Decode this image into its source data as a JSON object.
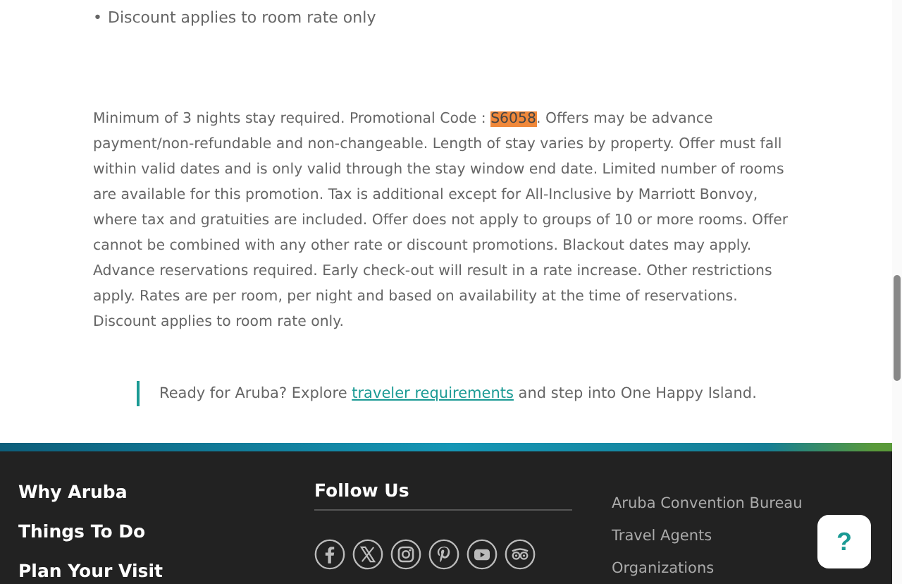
{
  "bullet_item": {
    "bullet": "•",
    "text": "Discount applies to room rate only"
  },
  "terms": {
    "before": "Minimum of 3 nights stay required. Promotional Code : ",
    "code": "S6058",
    "after": ". Offers may be advance payment/non-refundable and non-changeable. Length of stay varies by property. Offer must fall within valid dates and is only valid through the stay window end date. Limited number of rooms are available for this promotion. Tax is additional except for All-Inclusive by Marriott Bonvoy, where tax and gratuities are included. Offer does not apply to groups of 10 or more rooms. Offer cannot be combined with any other rate or discount promotions. Blackout dates may apply. Advance reservations required. Early check-out will result in a rate increase. Other restrictions apply. Rates are per room, per night and based on availability at the time of reservations. Discount applies to room rate only."
  },
  "callout": {
    "before": "Ready for Aruba? Explore ",
    "link": "traveler requirements",
    "after": " and step into One Happy Island."
  },
  "footer": {
    "nav": [
      "Why Aruba",
      "Things To Do",
      "Plan Your Visit"
    ],
    "follow_heading": "Follow Us",
    "social": [
      {
        "kind": "facebook"
      },
      {
        "kind": "x"
      },
      {
        "kind": "instagram"
      },
      {
        "kind": "pinterest"
      },
      {
        "kind": "youtube"
      },
      {
        "kind": "tripadvisor"
      }
    ],
    "links": [
      "Aruba Convention Bureau",
      "Travel Agents",
      "Organizations"
    ],
    "help_button": "?"
  }
}
